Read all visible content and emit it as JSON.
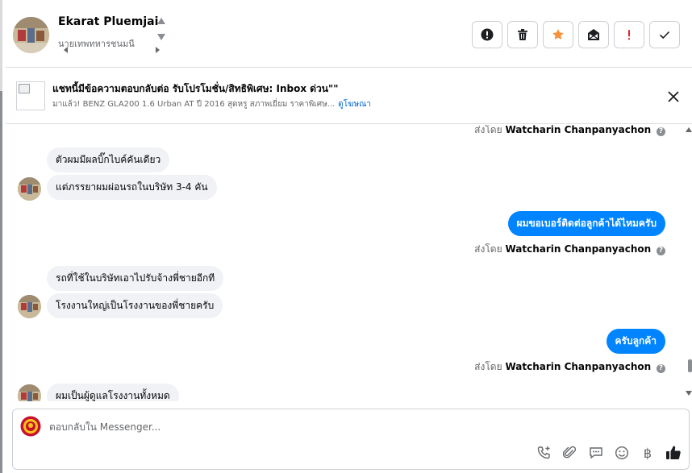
{
  "header": {
    "contact_name": "Ekarat Pluemjai",
    "contact_sub": "นายเทพทหารชนมนี"
  },
  "ad": {
    "title": "แชทนี้มีข้อความตอบกลับต่อ รับโปรโมชั่น/สิทธิพิเศษ: Inbox ด่วน\"\"",
    "desc": "มาแล้ว! BENZ GLA200 1.6 Urban AT ปี 2016 สุดหรู สภาพเยี่ยม ราคาพิเศษ...",
    "link": "ดูโฆษณา"
  },
  "messages": {
    "sent_by_prefix": "ส่งโดย",
    "agent_name": "Watcharin Chanpanyachon",
    "info": "?",
    "in_1": "ตัวผมมีผลบิ๊กไบค์คันเดียว",
    "in_2": "แต่ภรรยาผมผ่อนรถในบริษัท 3-4 คัน",
    "out_1": "ผมขอเบอร์ติดต่อลูกค้าได้ไหมครับ",
    "in_3": "รถที่ใช้ในบริษัทเอาไปรับจ้างพี่ชายอีกที",
    "in_4": "โรงงานใหญ่เป็นโรงงานของพี่ชายครับ",
    "out_2": "ครับลูกค้า",
    "in_5": "ผมเป็นผู้ดูแลโรงงานทั้งหมด"
  },
  "composer": {
    "placeholder": "ตอบกลับใน Messenger...",
    "currency_symbol": "฿"
  },
  "colors": {
    "brand_blue": "#0084ff",
    "star_orange": "#f7923b",
    "alert_red": "#e4262c",
    "incoming_bubble": "#f0f2f5"
  }
}
